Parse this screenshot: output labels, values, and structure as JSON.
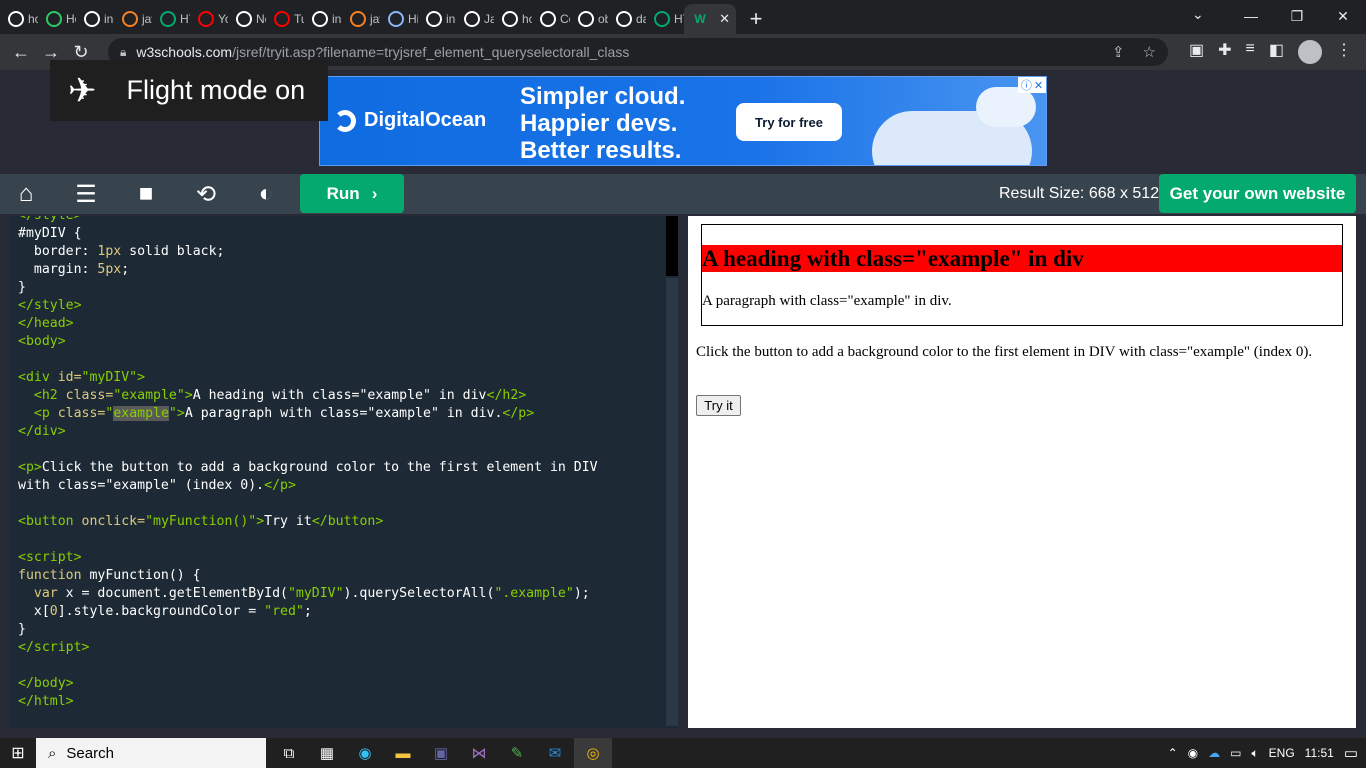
{
  "browser": {
    "tabs": [
      {
        "label": "how",
        "icon": "google-icon",
        "color": "#ffffff"
      },
      {
        "label": "Ho",
        "icon": "hackerrank-icon",
        "color": "#2ec866"
      },
      {
        "label": "incl",
        "icon": "google-icon",
        "color": "#ffffff"
      },
      {
        "label": "java",
        "icon": "stackoverflow-icon",
        "color": "#f48024"
      },
      {
        "label": "HTI",
        "icon": "w3schools-icon",
        "color": "#04aa6d"
      },
      {
        "label": "You",
        "icon": "youtube-icon",
        "color": "#ff0000"
      },
      {
        "label": "Ne",
        "icon": "github-icon",
        "color": "#ffffff"
      },
      {
        "label": "Tut",
        "icon": "youtube-icon",
        "color": "#ff0000"
      },
      {
        "label": "inse",
        "icon": "google-icon",
        "color": "#ffffff"
      },
      {
        "label": "java",
        "icon": "stackoverflow-icon",
        "color": "#f48024"
      },
      {
        "label": "His",
        "icon": "history-icon",
        "color": "#8ab4f8"
      },
      {
        "label": "incl",
        "icon": "google-icon",
        "color": "#ffffff"
      },
      {
        "label": "Jav",
        "icon": "terminal-icon",
        "color": "#ffffff"
      },
      {
        "label": "hov",
        "icon": "google-icon",
        "color": "#ffffff"
      },
      {
        "label": "Cor",
        "icon": "codechef-icon",
        "color": "#ffffff"
      },
      {
        "label": "obj",
        "icon": "google-icon",
        "color": "#ffffff"
      },
      {
        "label": "dat",
        "icon": "google-icon",
        "color": "#ffffff"
      },
      {
        "label": "HTI",
        "icon": "w3schools-icon",
        "color": "#04aa6d"
      }
    ],
    "active_tab": {
      "icon": "w3schools-icon",
      "close": "✕"
    },
    "new_tab": "+",
    "url_host": "w3schools.com",
    "url_path": "/jsref/tryit.asp?filename=tryjsref_element_queryselectorall_class"
  },
  "overlay": {
    "flight_mode": "Flight mode on"
  },
  "ad": {
    "brand": "DigitalOcean",
    "line1": "Simpler cloud.",
    "line2": "Happier devs.",
    "line3": "Better results.",
    "cta": "Try for free"
  },
  "editor_toolbar": {
    "run_label": "Run",
    "result_size": "Result Size: 668 x 512",
    "get_website": "Get your own website"
  },
  "result": {
    "heading": "A heading with class=\"example\" in div",
    "div_paragraph": "A paragraph with class=\"example\" in div.",
    "instruction": "Click the button to add a background color to the first element in DIV with class=\"example\" (index 0).",
    "button": "Try it"
  },
  "taskbar": {
    "search": "Search",
    "language": "ENG",
    "time": "11:51"
  }
}
